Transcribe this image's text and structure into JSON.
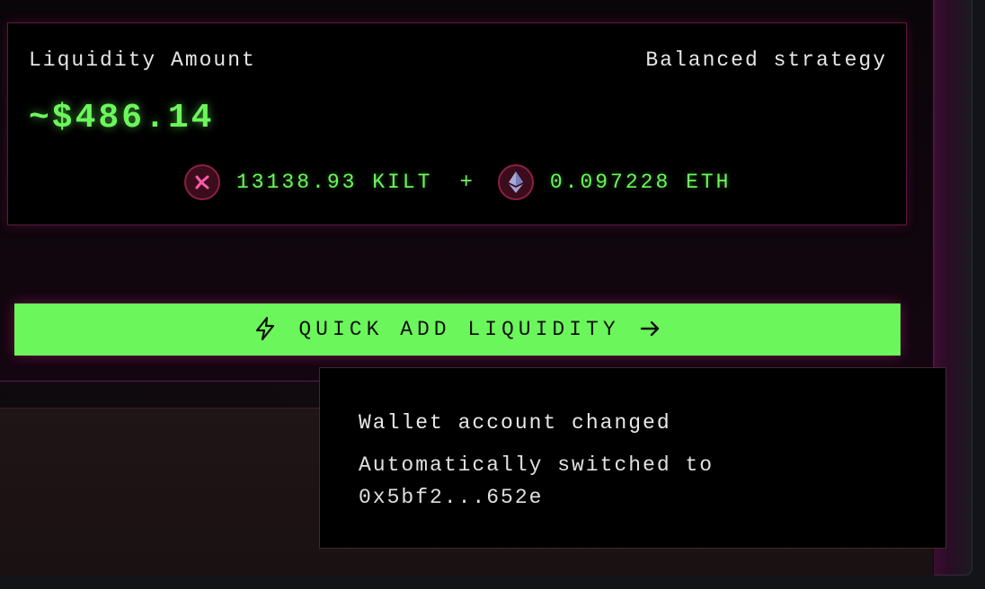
{
  "liquidity": {
    "label": "Liquidity Amount",
    "strategy": "Balanced strategy",
    "amount": "~$486.14",
    "tokens": [
      {
        "icon": "kilt-icon",
        "amount": "13138.93 KILT"
      },
      {
        "icon": "eth-icon",
        "amount": "0.097228 ETH"
      }
    ],
    "separator": "+"
  },
  "actions": {
    "quick_add_label": "QUICK ADD LIQUIDITY"
  },
  "toast": {
    "title": "Wallet account changed",
    "message": "Automatically switched to 0x5bf2...652e"
  },
  "colors": {
    "accent_green": "#6bf75b",
    "accent_pink": "#8a2142"
  }
}
